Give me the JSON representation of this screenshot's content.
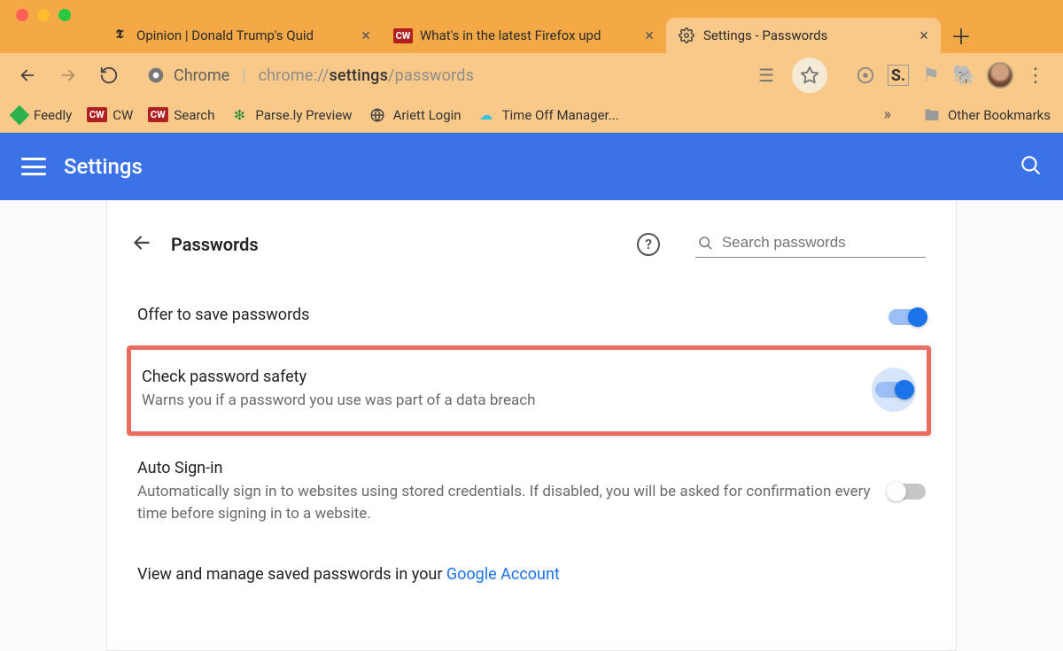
{
  "tabs": [
    {
      "label": "Opinion | Donald Trump's Quid",
      "favicon": "nyt"
    },
    {
      "label": "What's in the latest Firefox upd",
      "favicon": "cw"
    },
    {
      "label": "Settings - Passwords",
      "favicon": "gear",
      "active": true
    }
  ],
  "omnibox": {
    "host": "Chrome",
    "url_prefix": "chrome://",
    "url_bold": "settings",
    "url_suffix": "/passwords"
  },
  "bookmarks": [
    {
      "label": "Feedly",
      "icon": "feedly"
    },
    {
      "label": "CW",
      "icon": "cw"
    },
    {
      "label": "Search",
      "icon": "cw"
    },
    {
      "label": "Parse.ly Preview",
      "icon": "parsely"
    },
    {
      "label": "Ariett Login",
      "icon": "globe"
    },
    {
      "label": "Time Off Manager...",
      "icon": "cloud"
    }
  ],
  "bookmarks_other": "Other Bookmarks",
  "settings_header": {
    "title": "Settings"
  },
  "page": {
    "title": "Passwords",
    "search_placeholder": "Search passwords",
    "rows": {
      "offer_save": {
        "title": "Offer to save passwords",
        "on": true
      },
      "check_safety": {
        "title": "Check password safety",
        "desc": "Warns you if a password you use was part of a data breach",
        "on": true
      },
      "auto_signin": {
        "title": "Auto Sign-in",
        "desc": "Automatically sign in to websites using stored credentials. If disabled, you will be asked for confirmation every time before signing in to a website.",
        "on": false
      }
    },
    "view_manage_prefix": "View and manage saved passwords in your ",
    "view_manage_link": "Google Account"
  }
}
